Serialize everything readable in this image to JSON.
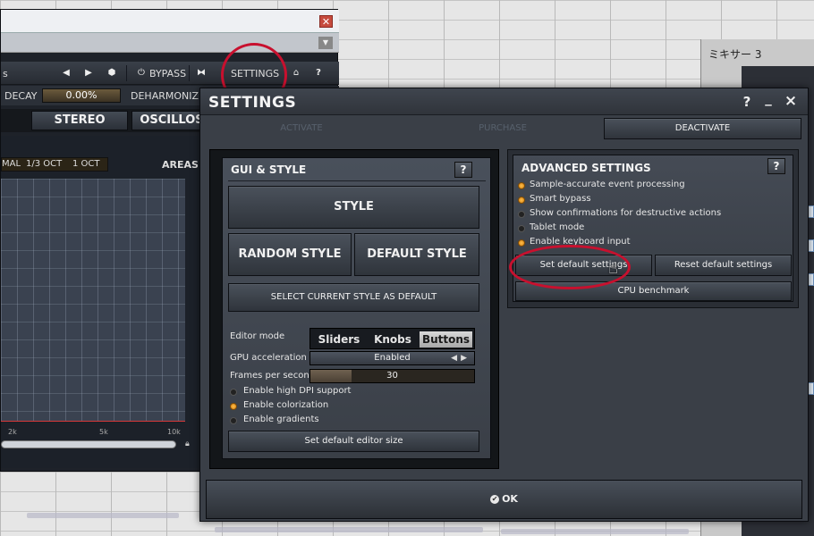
{
  "plugin": {
    "toolbar": {
      "left_text": "s",
      "bypass": "BYPASS",
      "settings": "SETTINGS",
      "help": "?"
    },
    "decay_label": "DECAY",
    "decay_value": "0.00%",
    "deharmonize_label": "DEHARMONIZE",
    "tabs": [
      "STEREO",
      "OSCILLOS"
    ],
    "analyzer": {
      "modes": [
        "MAL",
        "1/3 OCT",
        "1 OCT"
      ],
      "areas": "AREAS",
      "freq_ticks": [
        "2k",
        "5k",
        "10k"
      ]
    }
  },
  "mixer": {
    "title": "ミキサー 3"
  },
  "dialog": {
    "title": "SETTINGS",
    "help": "?",
    "minimize": "_",
    "close": "×",
    "activate": "ACTIVATE",
    "purchase": "PURCHASE",
    "deactivate": "DEACTIVATE",
    "gui": {
      "heading": "GUI & STYLE",
      "style": "STYLE",
      "random_style": "RANDOM STYLE",
      "default_style": "DEFAULT STYLE",
      "select_current": "SELECT CURRENT STYLE AS DEFAULT",
      "editor_mode_label": "Editor mode",
      "editor_modes": [
        "Sliders",
        "Knobs",
        "Buttons"
      ],
      "editor_mode_selected": "Buttons",
      "gpu_label": "GPU acceleration",
      "gpu_value": "Enabled",
      "fps_label": "Frames per second",
      "fps_value": "30",
      "fps_fill_ratio": 0.25,
      "options": [
        {
          "label": "Enable high DPI support",
          "on": false
        },
        {
          "label": "Enable colorization",
          "on": true
        },
        {
          "label": "Enable gradients",
          "on": false
        }
      ],
      "set_editor_size": "Set default editor size"
    },
    "advanced": {
      "heading": "ADVANCED SETTINGS",
      "options": [
        {
          "label": "Sample-accurate event processing",
          "on": true
        },
        {
          "label": "Smart bypass",
          "on": true
        },
        {
          "label": "Show confirmations for destructive actions",
          "on": false
        },
        {
          "label": "Tablet mode",
          "on": false
        },
        {
          "label": "Enable keyboard input",
          "on": true
        }
      ],
      "set_default": "Set default settings",
      "reset_default": "Reset default settings",
      "cpu_benchmark": "CPU benchmark"
    },
    "ok": "OK"
  },
  "colors": {
    "accent_orange": "#e08a18",
    "annotation_red": "#c8102e"
  }
}
